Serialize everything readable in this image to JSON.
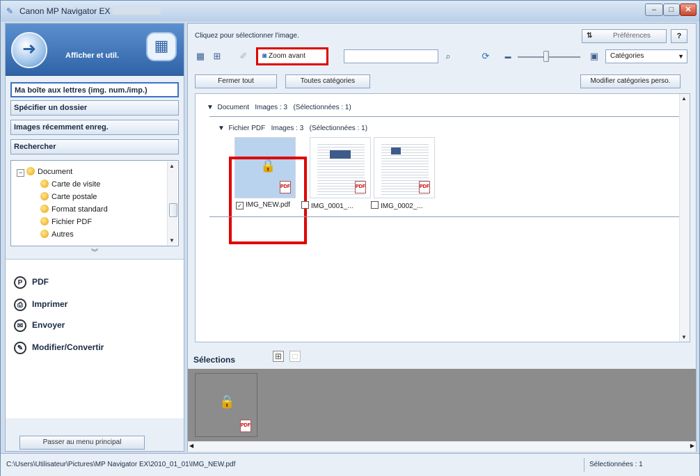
{
  "window": {
    "title": "Canon MP Navigator EX"
  },
  "left": {
    "hero_label": "Afficher et util.",
    "nav": [
      {
        "label": "Ma boîte aux lettres (img. num./imp.)",
        "active": true
      },
      {
        "label": "Spécifier un dossier",
        "active": false
      },
      {
        "label": "Images récemment enreg.",
        "active": false
      },
      {
        "label": "Rechercher",
        "active": false
      }
    ],
    "tree": {
      "root": "Document",
      "children": [
        "Carte de visite",
        "Carte postale",
        "Format standard",
        "Fichier PDF",
        "Autres"
      ]
    },
    "collapse_icon": "chevron-double-down-icon",
    "actions": [
      {
        "label": "PDF",
        "icon": "pdf-icon"
      },
      {
        "label": "Imprimer",
        "icon": "printer-icon"
      },
      {
        "label": "Envoyer",
        "icon": "mail-icon"
      },
      {
        "label": "Modifier/Convertir",
        "icon": "pencil-icon"
      }
    ],
    "main_menu_button": "Passer au menu principal"
  },
  "right": {
    "instruction": "Cliquez pour sélectionner l'image.",
    "preferences_button": "Préférences",
    "help_button": "?",
    "toolbar": {
      "zoom_button": "Zoom avant",
      "search_value": "",
      "category_select": "Catégories"
    },
    "buttons": {
      "close_all": "Fermer tout",
      "all_categories": "Toutes catégories",
      "modify_custom": "Modifier catégories perso."
    },
    "groups": {
      "document": {
        "name": "Document",
        "images": "Images : 3",
        "selected": "(Sélectionnées : 1)"
      },
      "pdf": {
        "name": "Fichier PDF",
        "images": "Images : 3",
        "selected": "(Sélectionnées : 1)"
      }
    },
    "thumbnails": [
      {
        "name": "IMG_NEW.pdf",
        "checked": true
      },
      {
        "name": "IMG_0001_...",
        "checked": false
      },
      {
        "name": "IMG_0002_...",
        "checked": false
      }
    ],
    "selections_label": "Sélections"
  },
  "status": {
    "path": "C:\\Users\\Utilisateur\\Pictures\\MP Navigator EX\\2010_01_01\\IMG_NEW.pdf",
    "selected": "Sélectionnées : 1"
  },
  "colors": {
    "highlight": "#e00000",
    "selected_thumb": "#b9d2ee",
    "hero": "#2f63a7"
  }
}
